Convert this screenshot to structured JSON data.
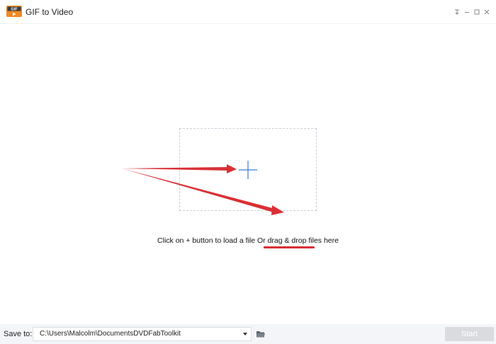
{
  "titlebar": {
    "app_icon_text": "GIF",
    "title": "GIF to Video",
    "controls": [
      "pin-icon",
      "minimize-icon",
      "maximize-icon",
      "close-icon"
    ]
  },
  "main": {
    "add_icon": "plus-icon",
    "hint": "Click on + button to load a file Or drag & drop files here"
  },
  "footer": {
    "save_label": "Save to:",
    "save_path": "C:\\Users\\Malcolm\\DocumentsDVDFabToolkit",
    "folder_icon": "folder-icon",
    "start_label": "Start"
  },
  "colors": {
    "accent_blue": "#3b7fd4",
    "annotation_red": "#d93036",
    "drop_border": "#c9cfd9",
    "footer_bg": "#f3f5f8",
    "start_disabled": "#d9dbdf",
    "app_icon_orange": "#f08a24"
  }
}
